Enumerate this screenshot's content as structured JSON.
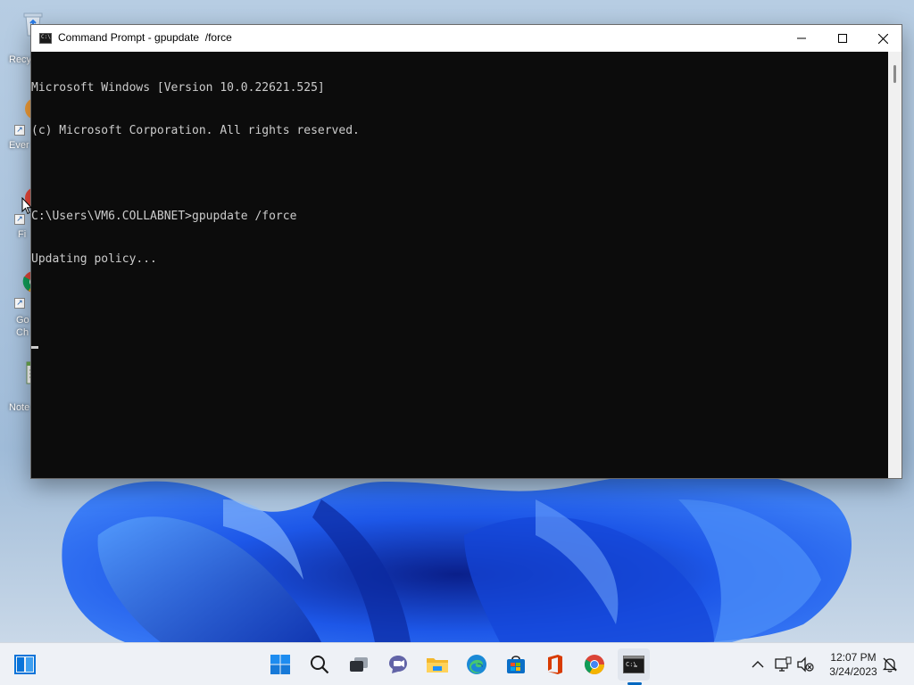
{
  "desktop": {
    "icons": [
      {
        "label": "Recy",
        "type": "recycle-bin"
      },
      {
        "label": "Ever",
        "type": "app"
      },
      {
        "label": "Fi",
        "type": "app"
      },
      {
        "label": "Go\nCh",
        "type": "browser"
      },
      {
        "label": "Note",
        "type": "notepad"
      }
    ]
  },
  "window": {
    "title": "Command Prompt - gpupdate  /force",
    "controls": {
      "minimize": "minimize-icon",
      "maximize": "maximize-icon",
      "close": "close-icon"
    }
  },
  "console": {
    "lines": [
      "Microsoft Windows [Version 10.0.22621.525]",
      "(c) Microsoft Corporation. All rights reserved.",
      "",
      "C:\\Users\\VM6.COLLABNET>gpupdate /force",
      "Updating policy...",
      ""
    ]
  },
  "taskbar": {
    "items": [
      {
        "name": "windows-start",
        "icon": "windows-logo-icon"
      },
      {
        "name": "search",
        "icon": "search-icon"
      },
      {
        "name": "task-view",
        "icon": "task-view-icon"
      },
      {
        "name": "teams-chat",
        "icon": "chat-icon"
      },
      {
        "name": "file-explorer",
        "icon": "folder-icon"
      },
      {
        "name": "edge",
        "icon": "edge-icon"
      },
      {
        "name": "store",
        "icon": "store-icon"
      },
      {
        "name": "office",
        "icon": "office-icon"
      },
      {
        "name": "chrome",
        "icon": "chrome-icon"
      },
      {
        "name": "command-prompt",
        "icon": "terminal-icon",
        "active": true
      }
    ],
    "tray": {
      "time": "12:07 PM",
      "date": "3/24/2023"
    }
  },
  "colors": {
    "console_bg": "#0c0c0c",
    "console_fg": "#cccccc",
    "accent": "#0067c0",
    "wallpaper_blue": "#1c58e6"
  }
}
